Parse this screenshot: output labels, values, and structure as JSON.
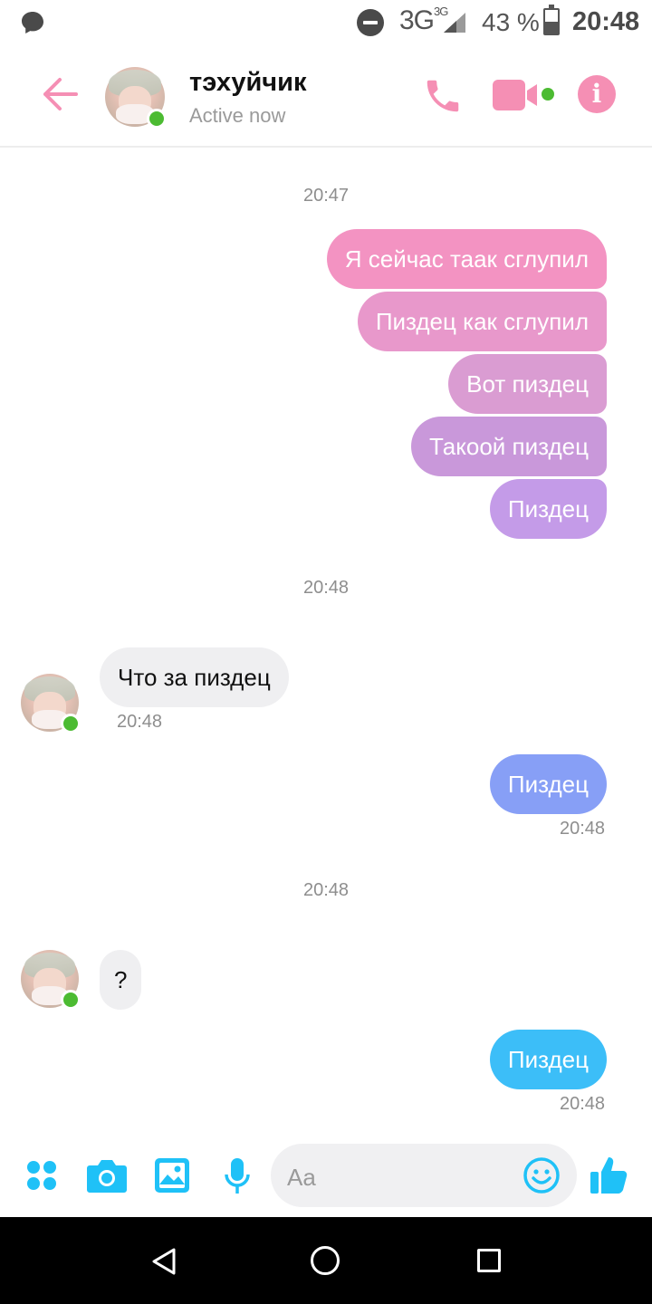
{
  "status_bar": {
    "network": "3G",
    "network_badge": "3G",
    "battery_percent": "43 %",
    "time": "20:48",
    "icons": [
      "messenger-bubble-icon",
      "do-not-disturb-icon",
      "signal-icon",
      "battery-charging-icon"
    ]
  },
  "header": {
    "contact_name": "тэхуйчик",
    "status": "Active now",
    "icons": [
      "back-arrow-icon",
      "phone-icon",
      "video-camera-icon",
      "info-icon"
    ],
    "accent": "#f58fb4",
    "online_color": "#4cbb32"
  },
  "messages": {
    "ts1": "20:47",
    "out1": "Я сейчас таак сглупил",
    "out2": "Пиздец как сглупил",
    "out3": "Вот пиздец",
    "out4": "Такоой пиздец",
    "out5": "Пиздец",
    "ts2": "20:48",
    "in1": "Что за пиздец",
    "in1_time": "20:48",
    "out6": "Пиздец",
    "out6_time": "20:48",
    "ts3": "20:48",
    "in2": "?",
    "out7": "Пиздец",
    "out7_time": "20:48",
    "colors": {
      "out1": "#f393c2",
      "out2": "#e898cb",
      "out3": "#da9cd2",
      "out4": "#c998da",
      "out5": "#c49be8",
      "out6": "#879ff6",
      "out7": "#3cbef8",
      "incoming": "#efeff1"
    }
  },
  "composer": {
    "placeholder": "Aa",
    "icons": [
      "apps-icon",
      "camera-icon",
      "gallery-icon",
      "microphone-icon",
      "emoji-icon",
      "thumbs-up-icon"
    ],
    "accent": "#1fc1f7"
  },
  "navbar": {
    "icons": [
      "nav-back-icon",
      "nav-home-icon",
      "nav-recents-icon"
    ]
  }
}
